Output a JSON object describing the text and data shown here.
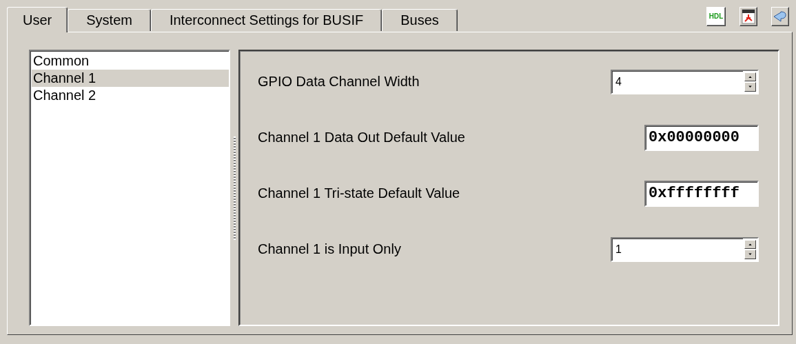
{
  "tabs": [
    {
      "label": "User",
      "selected": true
    },
    {
      "label": "System",
      "selected": false
    },
    {
      "label": "Interconnect Settings for BUSIF",
      "selected": false
    },
    {
      "label": "Buses",
      "selected": false
    }
  ],
  "toolbar": [
    {
      "kind": "hdl",
      "label": "HDL"
    },
    {
      "kind": "pdf"
    },
    {
      "kind": "back"
    }
  ],
  "sidebar": {
    "items": [
      {
        "label": "Common",
        "selected": false
      },
      {
        "label": "Channel 1",
        "selected": true
      },
      {
        "label": "Channel 2",
        "selected": false
      }
    ]
  },
  "parameters": [
    {
      "label": "GPIO Data Channel Width",
      "kind": "spinner",
      "value": "4"
    },
    {
      "label": "Channel 1 Data Out Default Value",
      "kind": "text",
      "value": "0x00000000"
    },
    {
      "label": "Channel 1 Tri-state Default Value",
      "kind": "text",
      "value": "0xffffffff"
    },
    {
      "label": "Channel 1 is Input Only",
      "kind": "spinner",
      "value": "1"
    }
  ]
}
